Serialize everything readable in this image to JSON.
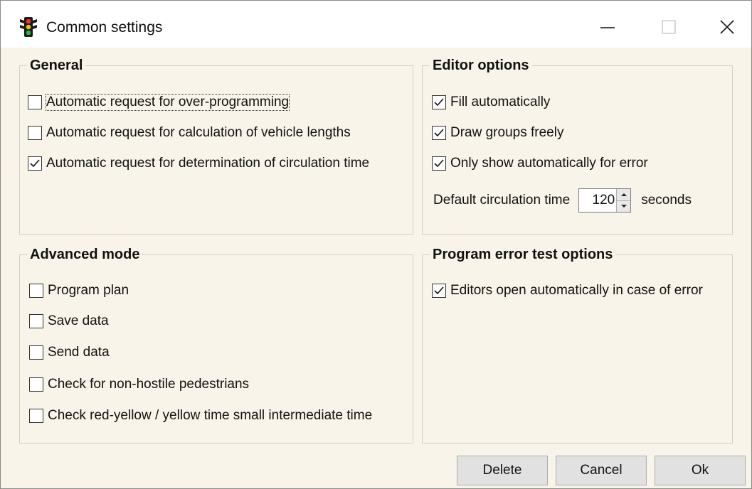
{
  "window": {
    "title": "Common settings",
    "icon": "traffic-light-icon",
    "controls": [
      "minimize-icon",
      "maximize-icon",
      "close-icon"
    ]
  },
  "general": {
    "title": "General",
    "items": [
      {
        "label": "Automatic request for over-programming",
        "checked": false
      },
      {
        "label": "Automatic request for calculation of vehicle lengths",
        "checked": false
      },
      {
        "label": "Automatic request for determination of circulation time",
        "checked": true
      }
    ]
  },
  "editor_options": {
    "title": "Editor options",
    "items": [
      {
        "label": "Fill automatically",
        "checked": true
      },
      {
        "label": "Draw groups freely",
        "checked": true
      },
      {
        "label": "Only show automatically for error",
        "checked": true
      }
    ],
    "circulation": {
      "label": "Default circulation time",
      "value": "120",
      "unit": "seconds"
    }
  },
  "advanced_mode": {
    "title": "Advanced mode",
    "items": [
      {
        "label": "Program plan",
        "checked": false
      },
      {
        "label": "Save data",
        "checked": false
      },
      {
        "label": "Send data",
        "checked": false
      },
      {
        "label": "Check for non-hostile pedestrians",
        "checked": false
      },
      {
        "label": "Check red-yellow / yellow time small intermediate time",
        "checked": false
      }
    ]
  },
  "program_error": {
    "title": "Program error test options",
    "items": [
      {
        "label": "Editors open automatically in case of error",
        "checked": true
      }
    ]
  },
  "buttons": {
    "delete": "Delete",
    "cancel": "Cancel",
    "ok": "Ok"
  },
  "colors": {
    "background": "#f8f4e9",
    "titlebar": "#ffffff",
    "button": "#e1e1e1",
    "border": "#d2cfc4"
  }
}
